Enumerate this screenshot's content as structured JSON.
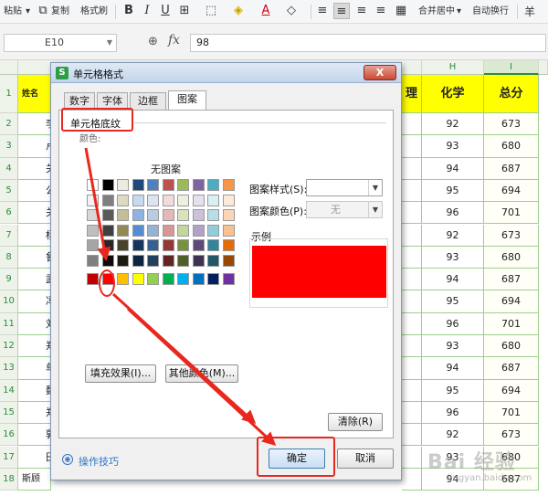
{
  "toolbar": {
    "paste": "粘贴",
    "copy": "复制",
    "format_painter": "格式刷",
    "bold": "B",
    "italic": "I",
    "underline": "U",
    "merge_center": "合并居中",
    "merge_dd": "▾",
    "wrap_text": "自动换行",
    "currency": "羊"
  },
  "formula_bar": {
    "cell_ref": "E10",
    "fx_label": "fx",
    "value": "98"
  },
  "sheet": {
    "col_headers": [
      "H",
      "I"
    ],
    "row_numbers": [
      "1",
      "2",
      "3",
      "4",
      "5",
      "6",
      "7",
      "8",
      "9",
      "10",
      "11",
      "12",
      "13",
      "14",
      "15",
      "16",
      "17",
      "18"
    ],
    "partial_header_right": "理",
    "header_chem": "化学",
    "header_total": "总分",
    "header_name_partial": "姓名",
    "chem": [
      "92",
      "93",
      "94",
      "95",
      "96",
      "92",
      "93",
      "94",
      "95",
      "96",
      "93",
      "94",
      "95",
      "96",
      "92",
      "93",
      "94"
    ],
    "total": [
      "673",
      "680",
      "687",
      "694",
      "701",
      "673",
      "680",
      "687",
      "694",
      "701",
      "680",
      "687",
      "694",
      "701",
      "673",
      "680",
      "687"
    ],
    "left_chars": [
      "",
      "李",
      "卢",
      "关",
      "公",
      "关",
      "杨",
      "鲁",
      "武",
      "冯",
      "刘",
      "郑",
      "单",
      "魏",
      "郑",
      "郭",
      "田"
    ],
    "last_row_name": "斯顾"
  },
  "dialog": {
    "title": "单元格格式",
    "close_label": "X",
    "tabs": [
      "数字",
      "字体",
      "边框",
      "图案"
    ],
    "active_tab": "图案",
    "group_title": "单元格底纹",
    "color_label": "颜色:",
    "no_pattern": "无图案",
    "fill_effects_btn": "填充效果(I)...",
    "more_colors_btn": "其他颜色(M)...",
    "pattern_style_label": "图案样式(S):",
    "pattern_color_label": "图案颜色(P):",
    "pattern_color_value": "无",
    "sample_label": "示例",
    "sample_color": "#ff0000",
    "clear_btn": "清除(R)",
    "ok_btn": "确定",
    "cancel_btn": "取消",
    "tips": "操作技巧",
    "palette": [
      [
        "#ffffff",
        "#000000",
        "#eeece1",
        "#1f497d",
        "#4f81bd",
        "#c0504d",
        "#9bbb59",
        "#8064a2",
        "#4bacc6",
        "#f79646",
        "#5b9bd5",
        "#70ad47"
      ],
      [
        "#f2f2f2",
        "#7f7f7f",
        "#ddd9c3",
        "#c6d9f0",
        "#dbe5f1",
        "#f2dcdb",
        "#ebf1dd",
        "#e5e0ec",
        "#dbeef3",
        "#fdeada",
        "#deebf6",
        "#e2efd9"
      ],
      [
        "#d8d8d8",
        "#595959",
        "#c4bd97",
        "#8db3e2",
        "#b8cce4",
        "#e5b9b7",
        "#d7e3bc",
        "#ccc1d9",
        "#b7dde8",
        "#fbd5b5",
        "#bdd7ee",
        "#c5e0b3"
      ],
      [
        "#bfbfbf",
        "#3f3f3f",
        "#938953",
        "#548dd4",
        "#95b3d7",
        "#d99694",
        "#c3d69b",
        "#b2a2c7",
        "#92cddc",
        "#fac08f",
        "#9cc3e5",
        "#a8d08d"
      ],
      [
        "#a5a5a5",
        "#262626",
        "#494429",
        "#17365d",
        "#366092",
        "#953734",
        "#76923c",
        "#5f497a",
        "#31859b",
        "#e36c09",
        "#2e75b5",
        "#538135"
      ],
      [
        "#7f7f7f",
        "#0c0c0c",
        "#1d1b10",
        "#0f243e",
        "#244061",
        "#632423",
        "#4f6128",
        "#3f3151",
        "#205867",
        "#974806",
        "#1e4e79",
        "#375623"
      ],
      [
        "#c00000",
        "#ff0000",
        "#ffc000",
        "#ffff00",
        "#92d050",
        "#00b050",
        "#00b0f0",
        "#0070c0",
        "#002060",
        "#7030a0"
      ]
    ]
  },
  "watermark": {
    "text": "Bai 经验",
    "sub": "jingyan.baidu.com"
  },
  "colors": {
    "accent_green": "#2e8b3e",
    "grid_green": "#9ccf8e",
    "header_yellow": "#ffff00",
    "annotation_red": "#e8281f"
  }
}
